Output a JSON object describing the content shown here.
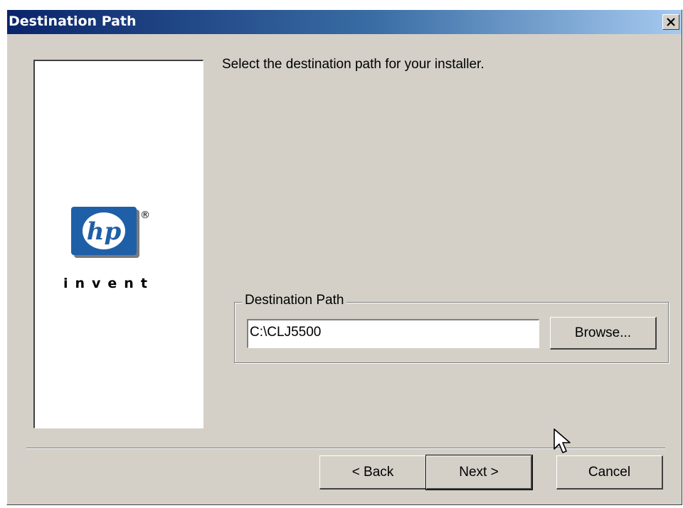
{
  "window": {
    "title": "Destination Path",
    "close_glyph": "×"
  },
  "banner": {
    "logo_text": "hp",
    "logo_tagline": "invent",
    "registered_mark": "®"
  },
  "main": {
    "instruction": "Select the destination path for your installer.",
    "group": {
      "label": "Destination Path",
      "path_value": "C:\\CLJ5500",
      "browse_label": "Browse..."
    }
  },
  "footer": {
    "back_label": "< Back",
    "next_label": "Next >",
    "cancel_label": "Cancel"
  },
  "colors": {
    "title_gradient_start": "#0a246a",
    "title_gradient_end": "#a6caf0",
    "dialog_face": "#d4d0c8",
    "hp_blue": "#1f5fa8"
  },
  "icons": {
    "close": "close-icon",
    "logo": "hp-logo-icon",
    "cursor": "mouse-cursor-icon"
  }
}
